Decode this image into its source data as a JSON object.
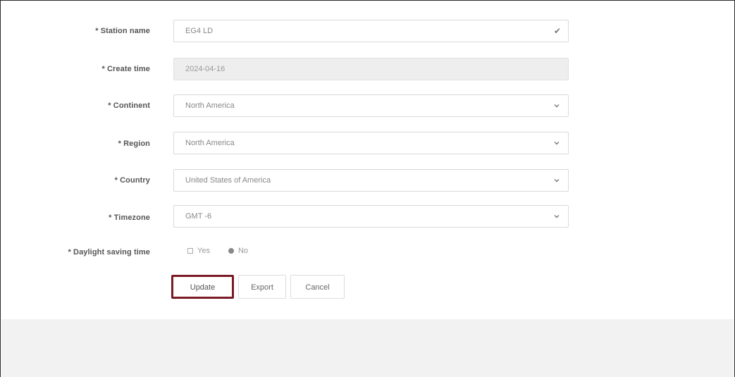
{
  "form": {
    "station_name": {
      "label": "* Station name",
      "value": "EG4 LD"
    },
    "create_time": {
      "label": "* Create time",
      "value": "2024-04-16"
    },
    "continent": {
      "label": "* Continent",
      "value": "North America"
    },
    "region": {
      "label": "* Region",
      "value": "North America"
    },
    "country": {
      "label": "* Country",
      "value": "United States of America"
    },
    "timezone": {
      "label": "* Timezone",
      "value": "GMT -6"
    },
    "daylight_saving": {
      "label": "* Daylight saving time",
      "options": [
        {
          "label": "Yes",
          "selected": false
        },
        {
          "label": "No",
          "selected": true
        }
      ]
    }
  },
  "buttons": {
    "update": "Update",
    "export": "Export",
    "cancel": "Cancel"
  },
  "icons": {
    "checkmark": "check-icon",
    "dropdown": "chevron-down-icon"
  },
  "colors": {
    "highlight_border": "#7a1a24",
    "footer_background": "#f2f2f2"
  }
}
